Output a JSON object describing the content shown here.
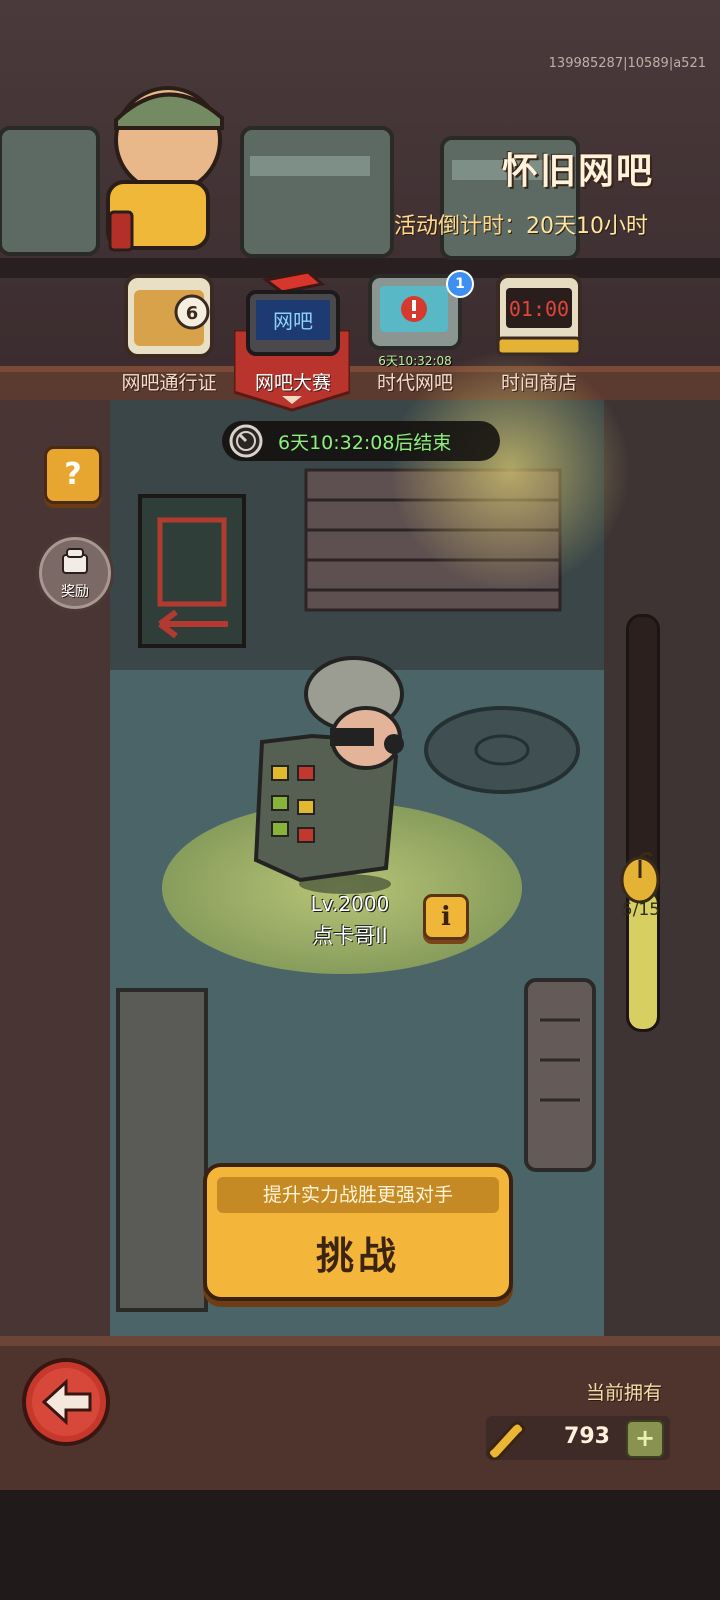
{
  "build_id": "139985287|10589|a521",
  "header": {
    "title": "怀旧网吧",
    "countdown_label": "活动倒计时：",
    "countdown_value": "20天10小时"
  },
  "tabs": [
    {
      "label": "网吧通行证",
      "icon": "pass-card-icon",
      "active": false
    },
    {
      "label": "网吧大赛",
      "icon": "netcafe-sign-icon",
      "active": true
    },
    {
      "label": "时代网吧",
      "icon": "alert-computer-icon",
      "active": false,
      "sub": "6天10:32:08",
      "badge": "1"
    },
    {
      "label": "时间商店",
      "icon": "digital-clock-icon",
      "active": false
    }
  ],
  "tab_art": {
    "pass_number": "6",
    "sign_text": "网吧",
    "clock_text": "01:00"
  },
  "event_timer": {
    "text": "6天10:32:08后结束"
  },
  "side_buttons": {
    "help": "?",
    "reward_label": "奖励"
  },
  "opponent": {
    "level": "Lv.2000",
    "name": "点卡哥II",
    "info_icon": "i"
  },
  "progress": {
    "current": 5,
    "max": 15,
    "text": "5/15"
  },
  "challenge": {
    "hint": "提升实力战胜更强对手",
    "label": "挑战"
  },
  "wallet": {
    "owned_label": "当前拥有",
    "amount": "793",
    "plus": "+"
  },
  "colors": {
    "accent": "#f3b53a",
    "timer_green": "#8cf07c",
    "tab_red": "#b8342c"
  }
}
